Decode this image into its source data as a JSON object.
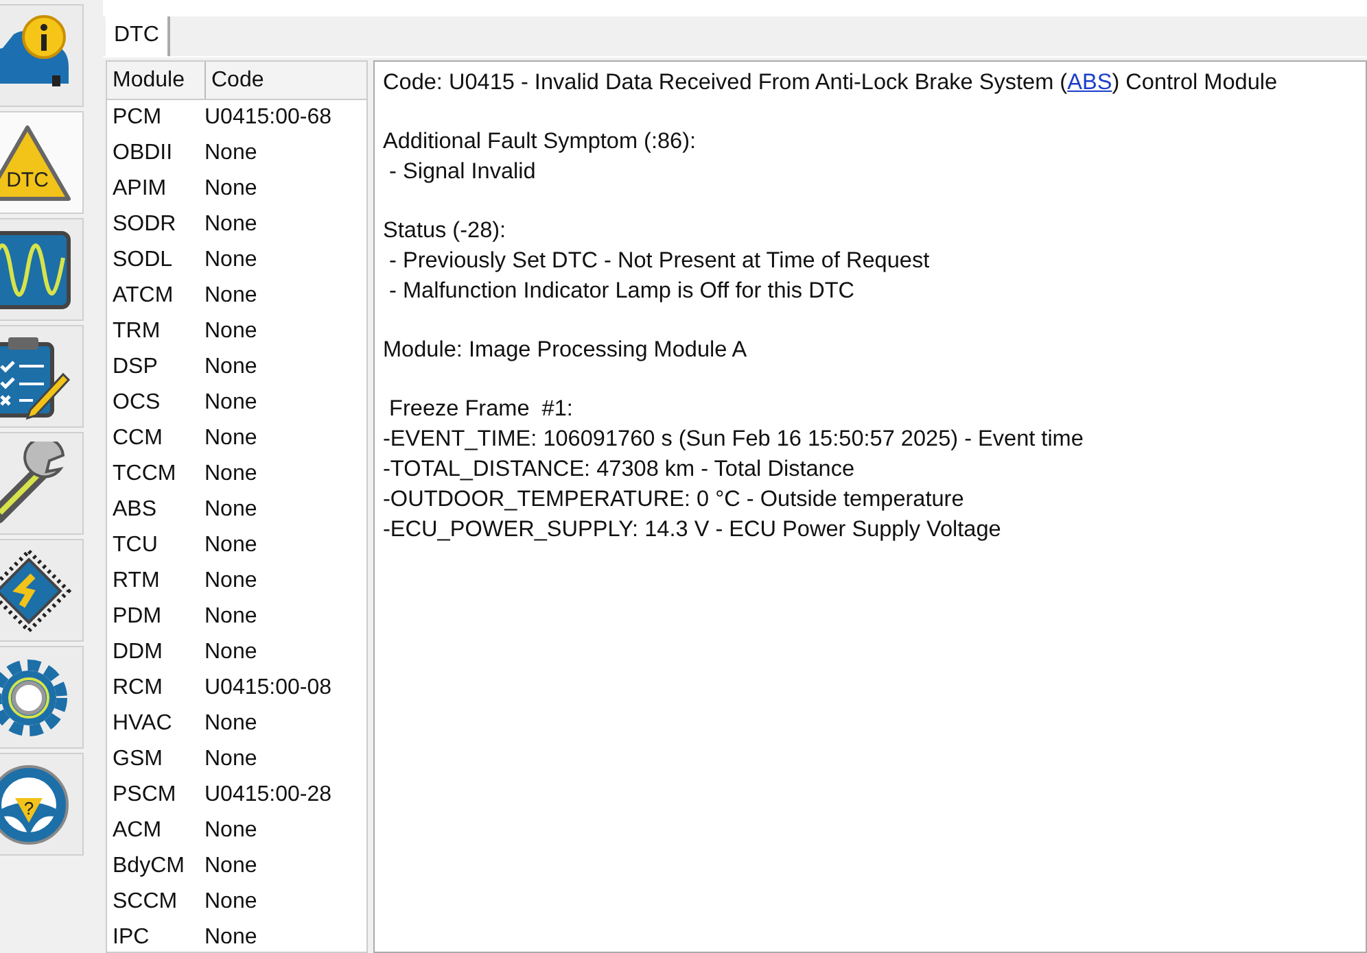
{
  "toolbar": [
    {
      "kind": "vehicle-info",
      "selected": false
    },
    {
      "kind": "dtc",
      "label": "DTC",
      "selected": true
    },
    {
      "kind": "oscilloscope",
      "selected": false
    },
    {
      "kind": "checklist",
      "selected": false
    },
    {
      "kind": "wrench",
      "selected": false
    },
    {
      "kind": "chip",
      "selected": false
    },
    {
      "kind": "gear",
      "selected": false
    },
    {
      "kind": "help",
      "label": "?",
      "selected": false
    }
  ],
  "tabs": [
    {
      "label": "DTC",
      "selected": true
    }
  ],
  "table": {
    "columns": [
      "Module",
      "Code"
    ],
    "rows": [
      [
        "PCM",
        "U0415:00-68"
      ],
      [
        "OBDII",
        "None"
      ],
      [
        "APIM",
        "None"
      ],
      [
        "SODR",
        "None"
      ],
      [
        "SODL",
        "None"
      ],
      [
        "ATCM",
        "None"
      ],
      [
        "TRM",
        "None"
      ],
      [
        "DSP",
        "None"
      ],
      [
        "OCS",
        "None"
      ],
      [
        "CCM",
        "None"
      ],
      [
        "TCCM",
        "None"
      ],
      [
        "ABS",
        "None"
      ],
      [
        "TCU",
        "None"
      ],
      [
        "RTM",
        "None"
      ],
      [
        "PDM",
        "None"
      ],
      [
        "DDM",
        "None"
      ],
      [
        "RCM",
        "U0415:00-08"
      ],
      [
        "HVAC",
        "None"
      ],
      [
        "GSM",
        "None"
      ],
      [
        "PSCM",
        "U0415:00-28"
      ],
      [
        "ACM",
        "None"
      ],
      [
        "BdyCM",
        "None"
      ],
      [
        "SCCM",
        "None"
      ],
      [
        "IPC",
        "None"
      ]
    ]
  },
  "detail": {
    "code_line": {
      "before": "Code: U0415 - Invalid Data Received From Anti-Lock Brake System (",
      "link": "ABS",
      "after": ") Control Module"
    },
    "blocks": [
      [
        "Additional Fault Symptom (:86):",
        " - Signal Invalid"
      ],
      [
        "Status (-28):",
        " - Previously Set DTC - Not Present at Time of Request",
        " - Malfunction Indicator Lamp is Off for this DTC"
      ],
      [
        "Module: Image Processing Module A"
      ],
      [
        " Freeze Frame  #1:",
        "-EVENT_TIME: 106091760 s (Sun Feb 16 15:50:57 2025) - Event time",
        "-TOTAL_DISTANCE: 47308 km - Total Distance",
        "-OUTDOOR_TEMPERATURE: 0 °C - Outside temperature",
        "-ECU_POWER_SUPPLY: 14.3 V - ECU Power Supply Voltage"
      ]
    ]
  }
}
